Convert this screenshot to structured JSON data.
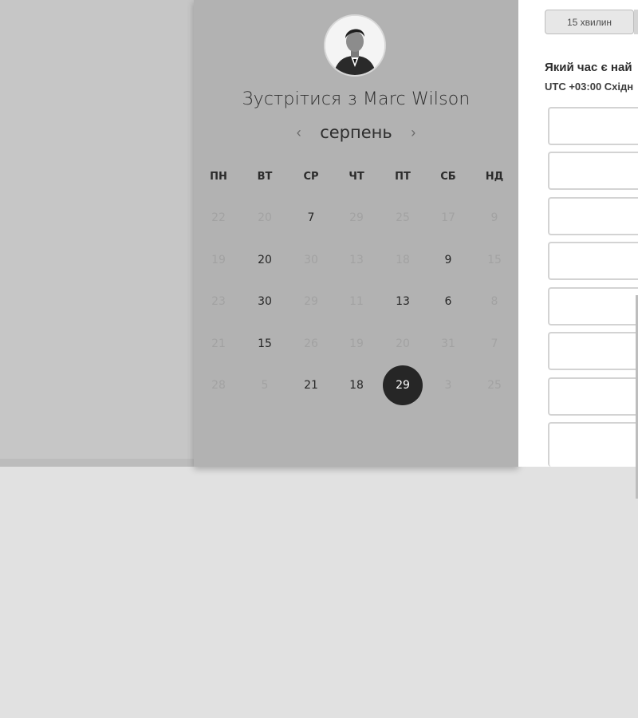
{
  "calendar": {
    "title": "Зустрітися з Marc Wilson",
    "month": "серпень",
    "prev_icon": "‹",
    "next_icon": "›",
    "weekdays": [
      "ПН",
      "ВТ",
      "СР",
      "ЧТ",
      "ПТ",
      "СБ",
      "НД"
    ],
    "weeks": [
      [
        {
          "d": "22",
          "a": false
        },
        {
          "d": "20",
          "a": false
        },
        {
          "d": "7",
          "a": true
        },
        {
          "d": "29",
          "a": false
        },
        {
          "d": "25",
          "a": false
        },
        {
          "d": "17",
          "a": false
        },
        {
          "d": "9",
          "a": false
        }
      ],
      [
        {
          "d": "19",
          "a": false
        },
        {
          "d": "20",
          "a": true
        },
        {
          "d": "30",
          "a": false
        },
        {
          "d": "13",
          "a": false
        },
        {
          "d": "18",
          "a": false
        },
        {
          "d": "9",
          "a": true
        },
        {
          "d": "15",
          "a": false
        }
      ],
      [
        {
          "d": "23",
          "a": false
        },
        {
          "d": "30",
          "a": true
        },
        {
          "d": "29",
          "a": false
        },
        {
          "d": "11",
          "a": false
        },
        {
          "d": "13",
          "a": true
        },
        {
          "d": "6",
          "a": true
        },
        {
          "d": "8",
          "a": false
        }
      ],
      [
        {
          "d": "21",
          "a": false
        },
        {
          "d": "15",
          "a": true
        },
        {
          "d": "26",
          "a": false
        },
        {
          "d": "19",
          "a": false
        },
        {
          "d": "20",
          "a": false
        },
        {
          "d": "31",
          "a": false
        },
        {
          "d": "7",
          "a": false
        }
      ],
      [
        {
          "d": "28",
          "a": false
        },
        {
          "d": "5",
          "a": false
        },
        {
          "d": "21",
          "a": true
        },
        {
          "d": "18",
          "a": true
        },
        {
          "d": "29",
          "a": true,
          "selected": true
        },
        {
          "d": "3",
          "a": false
        },
        {
          "d": "25",
          "a": false
        }
      ]
    ]
  },
  "scheduler": {
    "duration": "15 хвилин",
    "question": "Який час є най",
    "timezone": "UTC +03:00 Східн"
  }
}
